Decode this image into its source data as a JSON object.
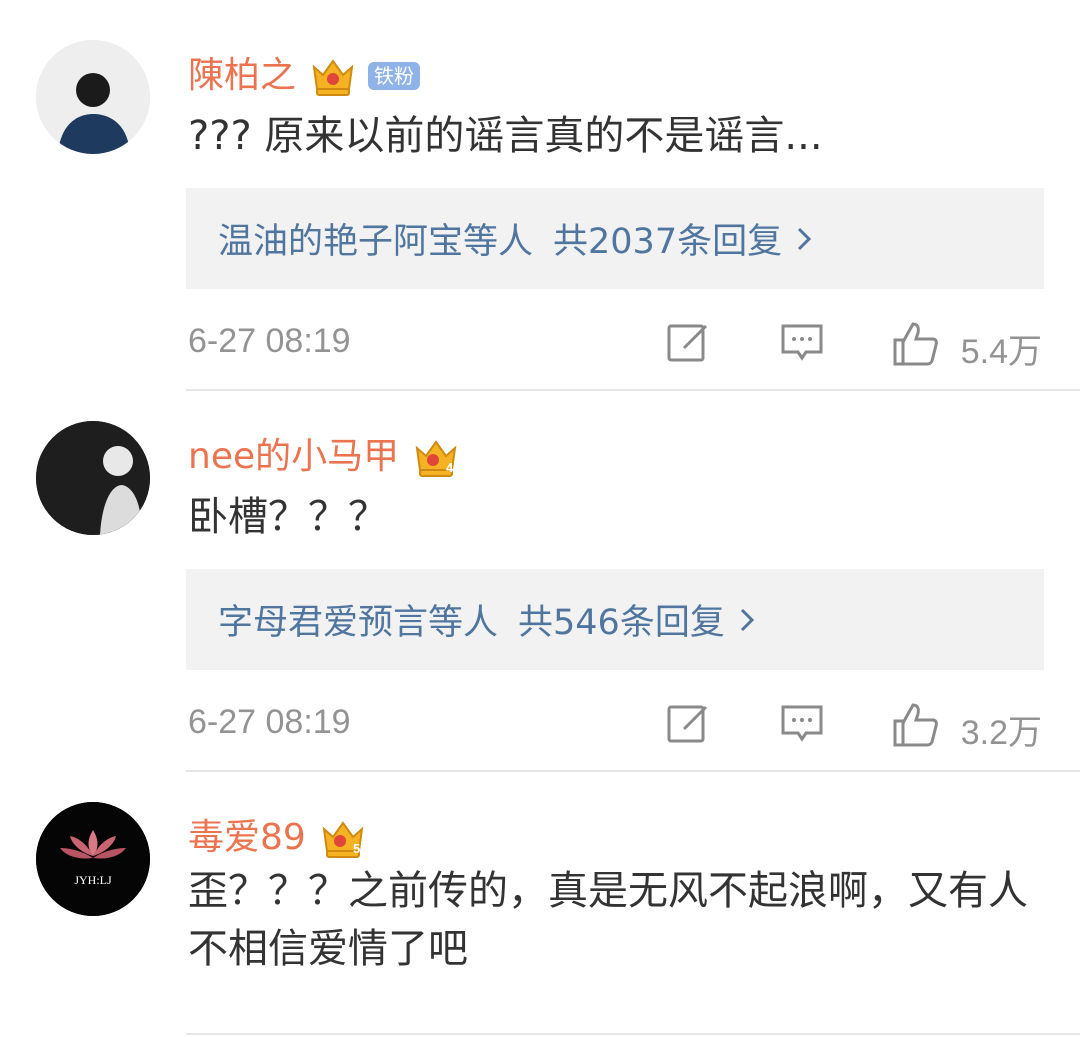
{
  "comments": [
    {
      "username": "陳柏之",
      "crown_level": "",
      "fan_badge": "铁粉",
      "text": "??? 原来以前的谣言真的不是谣言...",
      "reply_names": "温油的艳子阿宝等人",
      "reply_count": "共2037条回复",
      "time": "6-27 08:19",
      "likes": "5.4万"
    },
    {
      "username": "nee的小马甲",
      "crown_level": "4",
      "text": "卧槽？？？",
      "reply_names": "字母君爱预言等人",
      "reply_count": "共546条回复",
      "time": "6-27 08:19",
      "likes": "3.2万"
    },
    {
      "username": "毒爱89",
      "crown_level": "5",
      "text": "歪？？？之前传的，真是无风不起浪啊，又有人不相信爱情了吧",
      "avatar_text": "JYH:LJ"
    }
  ],
  "colors": {
    "username": "#eb7350",
    "reply_link": "#50759f",
    "meta": "#939393",
    "crown": "#f5b324"
  },
  "icons": [
    "crown-icon",
    "edit-icon",
    "comment-icon",
    "like-icon",
    "chevron-right-icon"
  ]
}
